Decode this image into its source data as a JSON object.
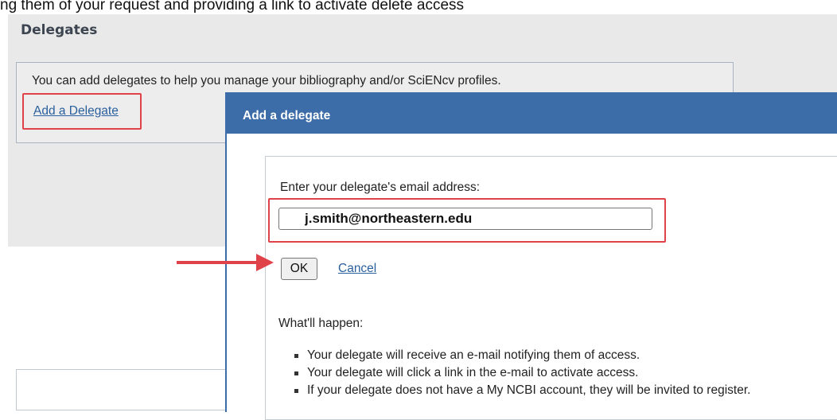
{
  "top_cut_text": "ng them of your request and providing a link to activate delete access",
  "delegates_section": {
    "title": "Delegates",
    "info": "You can add delegates to help you manage your bibliography and/or SciENcv profiles.",
    "add_link": "Add a Delegate"
  },
  "dialog": {
    "title": "Add a delegate",
    "email_label": "Enter your delegate's email address:",
    "email_value": "j.smith@northeastern.edu",
    "ok_label": "OK",
    "cancel_label": "Cancel",
    "happen_title": "What'll happen:",
    "steps": [
      "Your delegate will receive an e-mail notifying them of access.",
      "Your delegate will click a link in the e-mail to activate access.",
      "If your delegate does not have a My NCBI account, they will be invited to register."
    ]
  },
  "colors": {
    "dialog_header": "#3c6da8",
    "highlight": "#e0424a",
    "link": "#2a5f9e"
  }
}
